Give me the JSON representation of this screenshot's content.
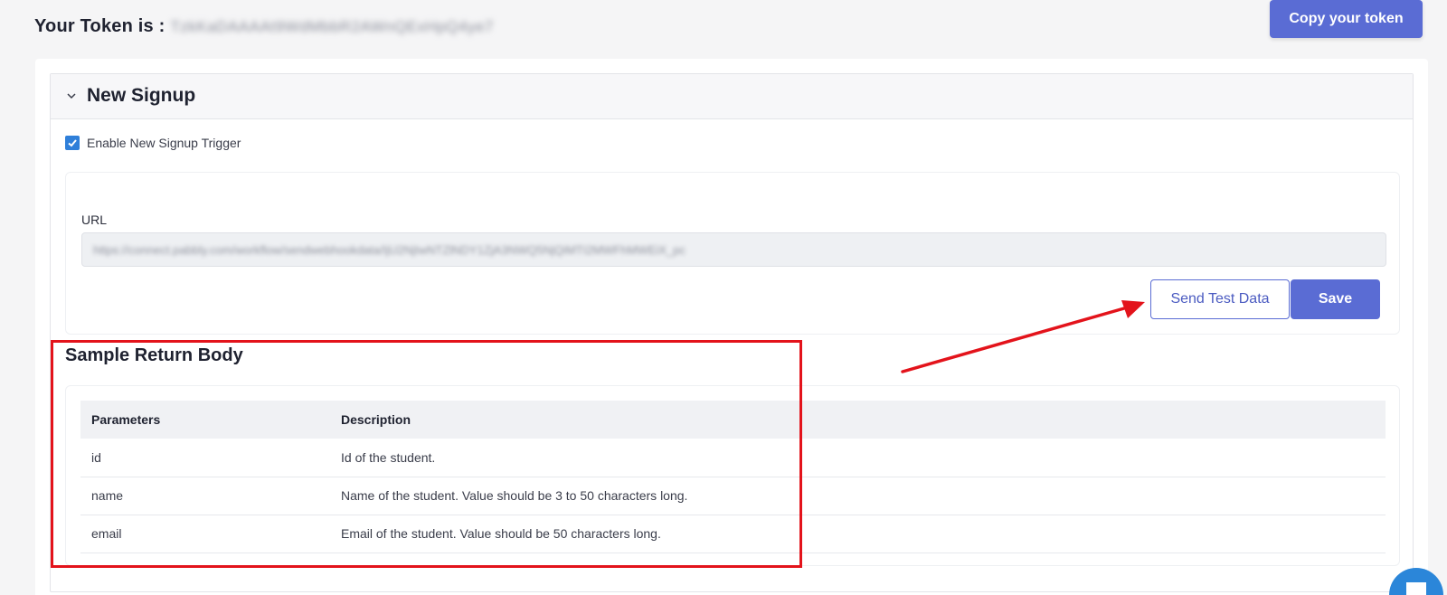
{
  "header": {
    "token_label": "Your Token is :",
    "token_value": "TzkKaDAAAAt9WdMbbR2AWnQExHpQ4ye7",
    "copy_button": "Copy your token"
  },
  "panel": {
    "title": "New Signup",
    "enable_label": "Enable New Signup Trigger",
    "enable_checked": true,
    "url_label": "URL",
    "url_value": "https://connect.pabbly.com/workflow/sendwebhookdata/IjU2NjIwNTZlNDY1ZjA3NWQ5NjQiMTI2MWFhMWEiX_pc",
    "send_test_button": "Send Test Data",
    "save_button": "Save"
  },
  "sample": {
    "title": "Sample Return Body",
    "columns": [
      "Parameters",
      "Description"
    ],
    "rows": [
      {
        "param": "id",
        "desc": "Id of the student."
      },
      {
        "param": "name",
        "desc": "Name of the student. Value should be 3 to 50 characters long."
      },
      {
        "param": "email",
        "desc": "Email of the student. Value should be 50 characters long."
      }
    ]
  },
  "colors": {
    "accent": "#5a6cd4",
    "annotation_red": "#e3131b",
    "checkbox_blue": "#2f7fd9"
  },
  "icons": {
    "collapse": "chevron-down-icon",
    "checkbox": "checkmark-icon",
    "chat": "chat-icon"
  }
}
